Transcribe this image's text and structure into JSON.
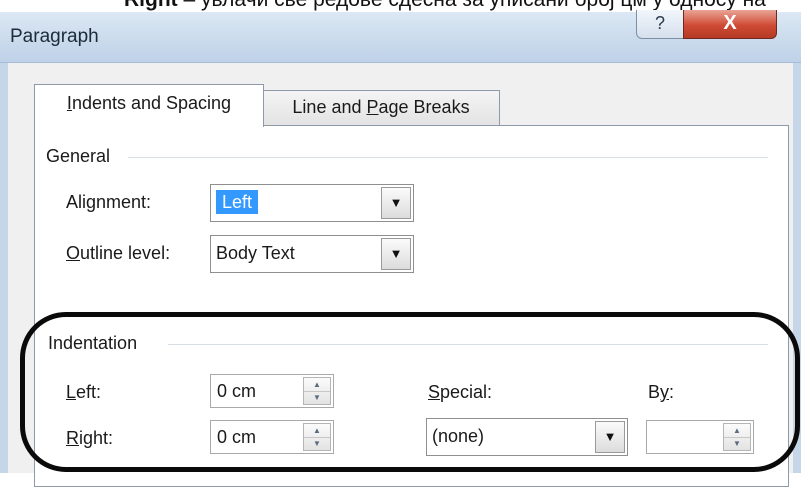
{
  "caption": {
    "bold_word": "Right",
    "rest": " – увлачи све редове сдесна за уписани број цм у односу на"
  },
  "window": {
    "title": "Paragraph",
    "help_glyph": "?",
    "close_glyph": "X"
  },
  "tabs": [
    {
      "label_pre": "",
      "label_u": "I",
      "label_post": "ndents and Spacing",
      "active": true
    },
    {
      "label_pre": "Line and ",
      "label_u": "P",
      "label_post": "age Breaks",
      "active": false
    }
  ],
  "general": {
    "header": "General",
    "alignment": {
      "label_pre": "Ali",
      "label_u": "g",
      "label_post": "nment:",
      "value": "Left"
    },
    "outline": {
      "label_pre": "",
      "label_u": "O",
      "label_post": "utline level:",
      "value": "Body Text"
    }
  },
  "indentation": {
    "header": "Indentation",
    "left": {
      "label_pre": "",
      "label_u": "L",
      "label_post": "eft:",
      "value": "0 cm"
    },
    "right": {
      "label_pre": "",
      "label_u": "R",
      "label_post": "ight:",
      "value": "0 cm"
    },
    "special": {
      "label_pre": "",
      "label_u": "S",
      "label_post": "pecial:",
      "value": "(none)"
    },
    "by": {
      "label_pre": "B",
      "label_u": "y",
      "label_post": ":",
      "value": ""
    }
  },
  "icons": {
    "dropdown": "chevron-down-icon",
    "spinner": "up-down-arrows-icon"
  }
}
